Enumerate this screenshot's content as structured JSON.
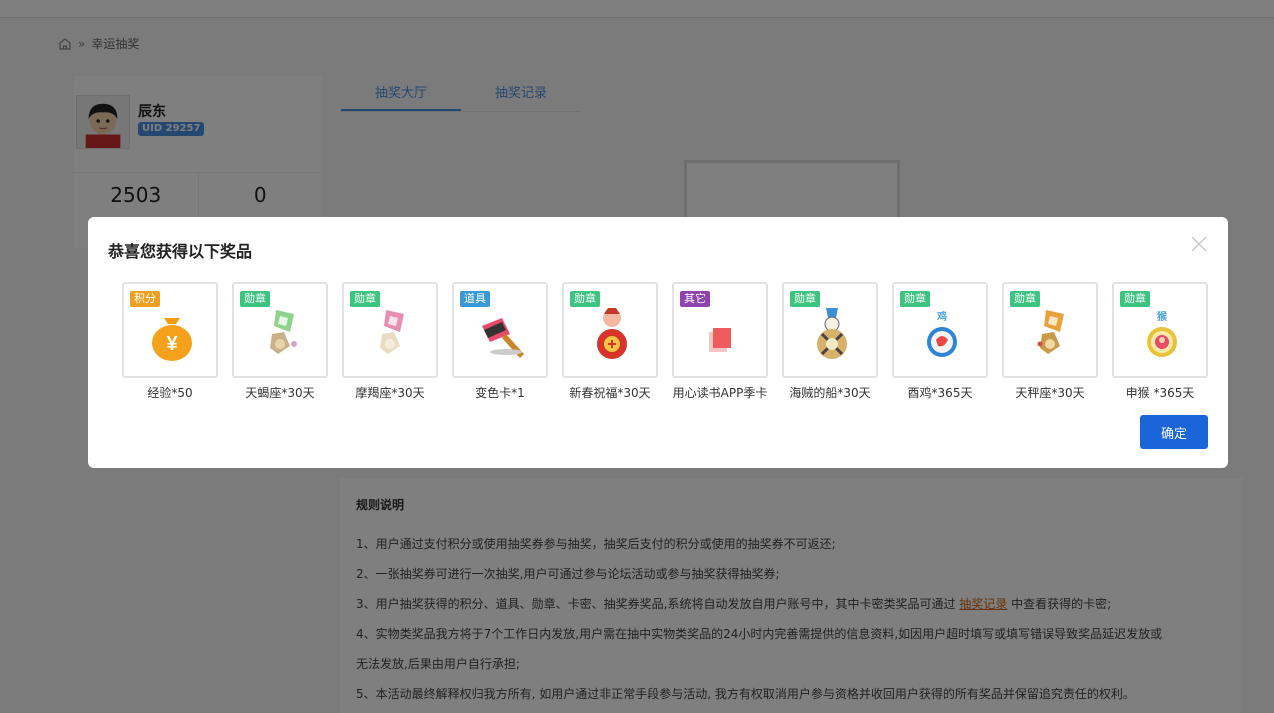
{
  "breadcrumb": {
    "home_icon": "home-icon",
    "separator": "»",
    "current": "幸运抽奖"
  },
  "profile": {
    "name": "辰东",
    "uid": "UID 29257",
    "stats": [
      "2503",
      "0"
    ]
  },
  "tabs": [
    {
      "label": "抽奖大厅",
      "active": true
    },
    {
      "label": "抽奖记录",
      "active": false
    }
  ],
  "rules": {
    "title": "规则说明",
    "items": [
      "1、用户通过支付积分或使用抽奖券参与抽奖，抽奖后支付的积分或使用的抽奖券不可返还;",
      "2、一张抽奖券可进行一次抽奖,用户可通过参与论坛活动或参与抽奖获得抽奖券;",
      "3、用户抽奖获得的积分、道具、勋章、卡密、抽奖券奖品,系统将自动发放自用户账号中，其中卡密类奖品可通过",
      "4、实物类奖品我方将于7个工作日内发放,用户需在抽中实物类奖品的24小时内完善需提供的信息资料,如因用户超时填写或填写错误导致奖品延迟发放或",
      "无法发放,后果由用户自行承担;",
      "5、本活动最终解释权归我方所有, 如用户通过非正常手段参与活动, 我方有权取消用户参与资格并收回用户获得的所有奖品并保留追究责任的权利。"
    ],
    "link_text": "抽奖记录",
    "item3_suffix": "中查看获得的卡密;"
  },
  "modal": {
    "title": "恭喜您获得以下奖品",
    "close_icon": "close-icon",
    "confirm_label": "确定",
    "prizes": [
      {
        "badge": "积分",
        "badge_color": "#f0a020",
        "label": "经验*50",
        "icon": "money-bag-icon"
      },
      {
        "badge": "勋章",
        "badge_color": "#3cc480",
        "label": "天蝎座*30天",
        "icon": "scorpio-medal-icon"
      },
      {
        "badge": "勋章",
        "badge_color": "#3cc480",
        "label": "摩羯座*30天",
        "icon": "capricorn-medal-icon"
      },
      {
        "badge": "道具",
        "badge_color": "#3a9ad9",
        "label": "变色卡*1",
        "icon": "paint-brush-icon"
      },
      {
        "badge": "勋章",
        "badge_color": "#3cc480",
        "label": "新春祝福*30天",
        "icon": "new-year-medal-icon"
      },
      {
        "badge": "其它",
        "badge_color": "#8e44ad",
        "label": "用心读书APP季卡",
        "icon": "card-icon"
      },
      {
        "badge": "勋章",
        "badge_color": "#3cc480",
        "label": "海贼的船*30天",
        "icon": "pirate-ship-medal-icon"
      },
      {
        "badge": "勋章",
        "badge_color": "#3cc480",
        "label": "酉鸡*365天",
        "icon": "rooster-medal-icon"
      },
      {
        "badge": "勋章",
        "badge_color": "#3cc480",
        "label": "天秤座*30天",
        "icon": "libra-medal-icon"
      },
      {
        "badge": "勋章",
        "badge_color": "#3cc480",
        "label": "申猴 *365天",
        "icon": "monkey-medal-icon"
      }
    ]
  }
}
